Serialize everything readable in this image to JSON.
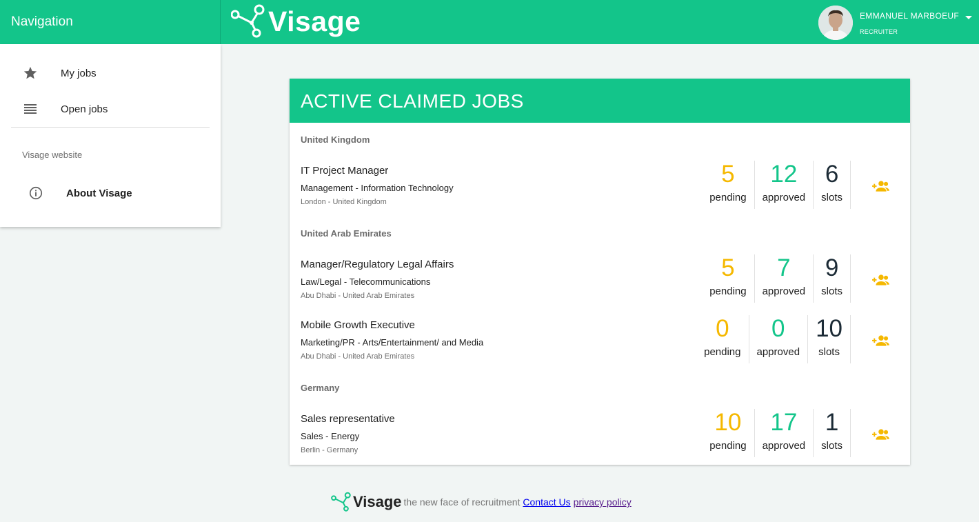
{
  "header": {
    "nav_title": "Navigation",
    "logo_text": "Visage",
    "user_name": "EMMANUEL MARBOEUF",
    "user_role": "RECRUITER"
  },
  "sidebar": {
    "items": [
      {
        "label": "My jobs",
        "icon": "star-icon"
      },
      {
        "label": "Open jobs",
        "icon": "list-icon"
      }
    ],
    "subheader": "Visage website",
    "about_label": "About Visage"
  },
  "card": {
    "title": "ACTIVE CLAIMED JOBS",
    "groups": [
      {
        "country": "United Kingdom",
        "jobs": [
          {
            "title": "IT Project Manager",
            "category": "Management - Information Technology",
            "location": "London - United Kingdom",
            "pending": "5",
            "approved": "12",
            "slots": "6"
          }
        ]
      },
      {
        "country": "United Arab Emirates",
        "jobs": [
          {
            "title": "Manager/Regulatory Legal Affairs",
            "category": "Law/Legal - Telecommunications",
            "location": "Abu Dhabi - United Arab Emirates",
            "pending": "5",
            "approved": "7",
            "slots": "9"
          },
          {
            "title": "Mobile Growth Executive",
            "category": "Marketing/PR - Arts/Entertainment/ and Media",
            "location": "Abu Dhabi - United Arab Emirates",
            "pending": "0",
            "approved": "0",
            "slots": "10"
          }
        ]
      },
      {
        "country": "Germany",
        "jobs": [
          {
            "title": "Sales representative",
            "category": "Sales - Energy",
            "location": "Berlin - Germany",
            "pending": "10",
            "approved": "17",
            "slots": "1"
          }
        ]
      }
    ],
    "labels": {
      "pending": "pending",
      "approved": "approved",
      "slots": "slots"
    }
  },
  "footer": {
    "logo_text": "Visage",
    "tagline": "the new face of recruitment",
    "contact": "Contact Us",
    "privacy": "privacy policy"
  },
  "colors": {
    "brand": "#13c58a",
    "pending": "#f5b800",
    "approved": "#13c58a",
    "slots": "#1c2b36",
    "assign_icon": "#f5b800"
  }
}
